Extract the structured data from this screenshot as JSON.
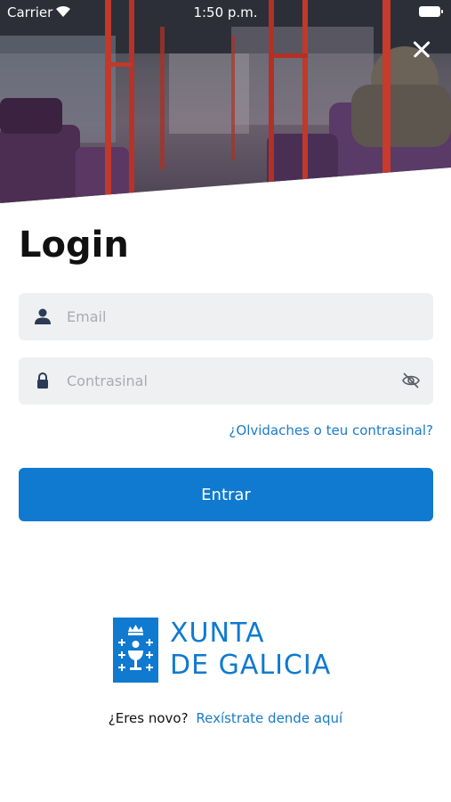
{
  "status_bar": {
    "carrier": "Carrier",
    "time": "1:50 p.m."
  },
  "header": {
    "image": "bus-interior-photo",
    "close_icon": "close-icon"
  },
  "login": {
    "title": "Login",
    "email_placeholder": "Email",
    "password_placeholder": "Contrasinal",
    "forgot_link": "¿Olvidaches o teu contrasinal?",
    "submit_label": "Entrar"
  },
  "brand": {
    "line1": "XUNTA",
    "line2": "DE GALICIA",
    "color": "#0f7ad0"
  },
  "register": {
    "question": "¿Eres novo?",
    "link": "Rexístrate dende aquí"
  },
  "colors": {
    "accent": "#0f7ad0",
    "link": "#1a7bc8",
    "field_bg": "#eff0f2"
  }
}
